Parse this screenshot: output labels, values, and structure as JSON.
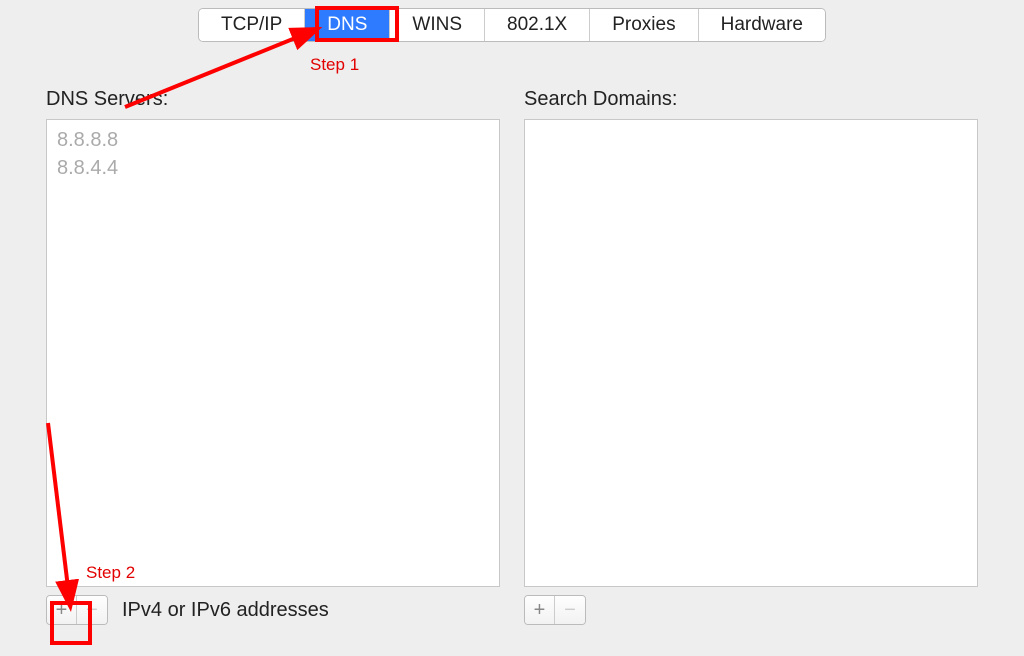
{
  "tabs": [
    {
      "label": "TCP/IP",
      "selected": false
    },
    {
      "label": "DNS",
      "selected": true
    },
    {
      "label": "WINS",
      "selected": false
    },
    {
      "label": "802.1X",
      "selected": false
    },
    {
      "label": "Proxies",
      "selected": false
    },
    {
      "label": "Hardware",
      "selected": false
    }
  ],
  "dns_panel": {
    "label": "DNS Servers:",
    "servers": [
      "8.8.8.8",
      "8.8.4.4"
    ],
    "footer_hint": "IPv4 or IPv6 addresses"
  },
  "search_panel": {
    "label": "Search Domains:"
  },
  "buttons": {
    "plus": "+",
    "minus": "−"
  },
  "annotations": {
    "step1": "Step 1",
    "step2": "Step 2"
  }
}
